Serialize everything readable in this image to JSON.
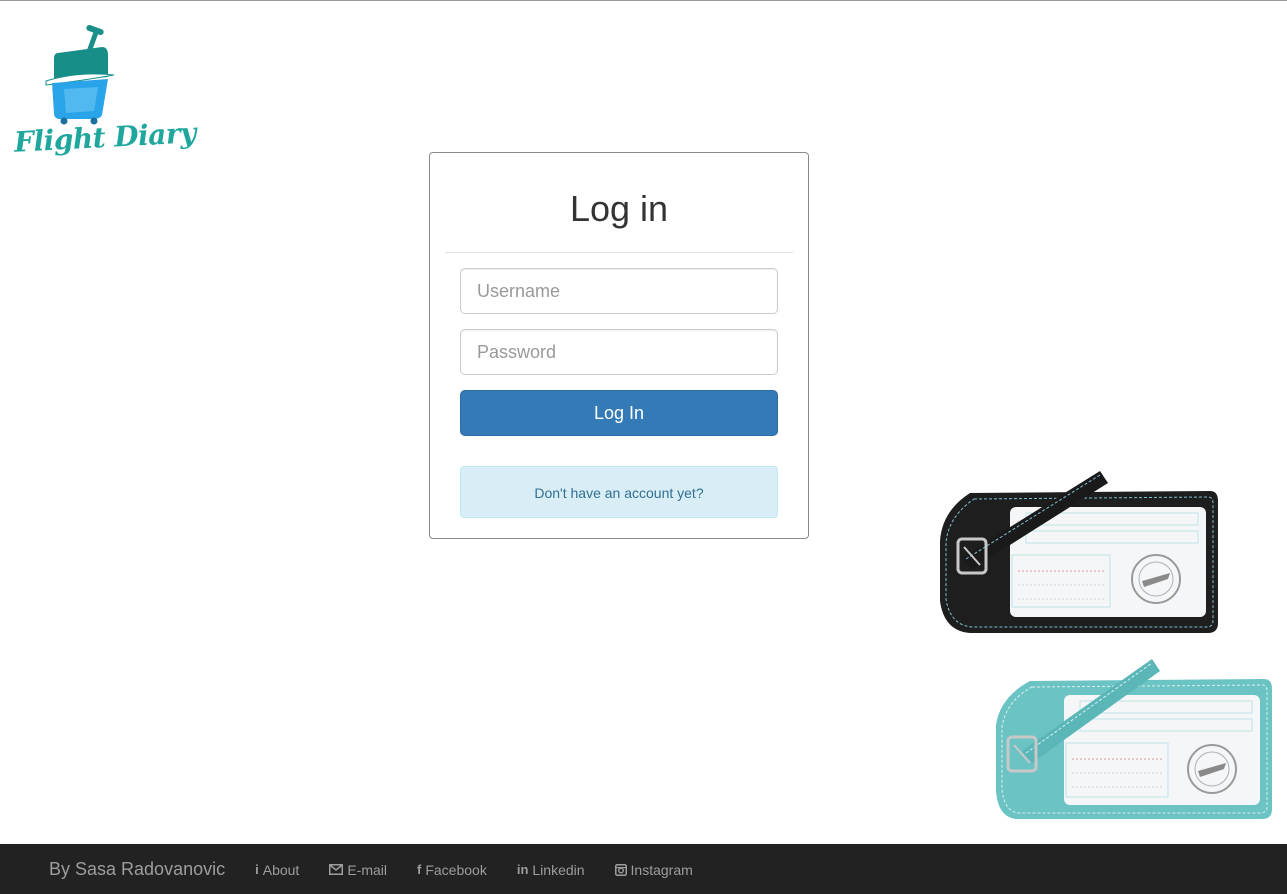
{
  "logo": {
    "text": "Flight Diary"
  },
  "login": {
    "title": "Log in",
    "username_placeholder": "Username",
    "password_placeholder": "Password",
    "submit_label": "Log In",
    "signup_link": "Don't have an account yet?"
  },
  "footer": {
    "brand": "By Sasa Radovanovic",
    "links": [
      {
        "label": "About",
        "icon": "info-icon"
      },
      {
        "label": "E-mail",
        "icon": "envelope-icon"
      },
      {
        "label": "Facebook",
        "icon": "facebook-icon"
      },
      {
        "label": "Linkedin",
        "icon": "linkedin-icon"
      },
      {
        "label": "Instagram",
        "icon": "instagram-icon"
      }
    ]
  },
  "colors": {
    "primary": "#337ab7",
    "info_bg": "#d9edf7",
    "info_text": "#31708f",
    "footer_bg": "#222222",
    "brand_teal": "#1fa79e"
  }
}
